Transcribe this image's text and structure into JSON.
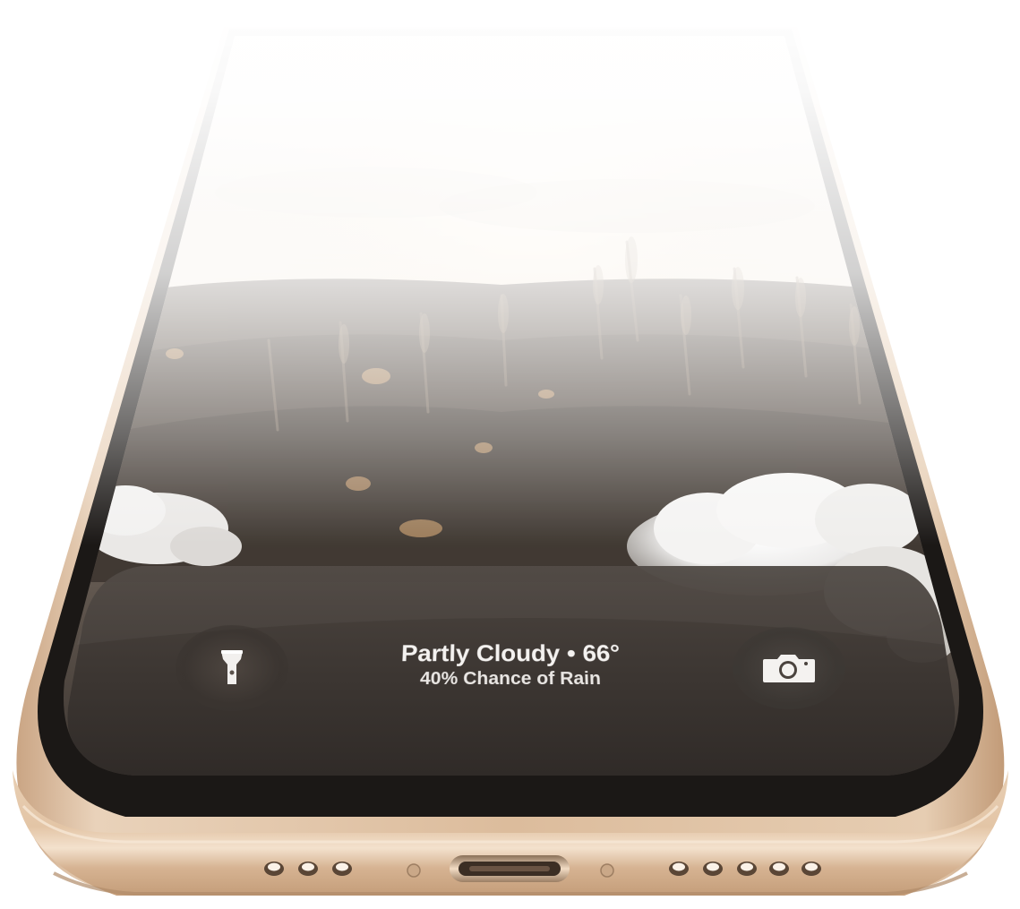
{
  "lock_screen": {
    "weather": {
      "condition": "Partly Cloudy",
      "separator": "•",
      "temperature": "66°",
      "rain_chance": "40% Chance of Rain"
    },
    "quick_actions": {
      "left": {
        "icon": "flashlight-icon"
      },
      "right": {
        "icon": "camera-icon"
      }
    }
  },
  "colors": {
    "frame_gold": "#d9b99a",
    "frame_highlight": "#f1dcc6",
    "bezel": "#1a1715",
    "panel": "#3e3834",
    "text": "#f4f2f0"
  }
}
